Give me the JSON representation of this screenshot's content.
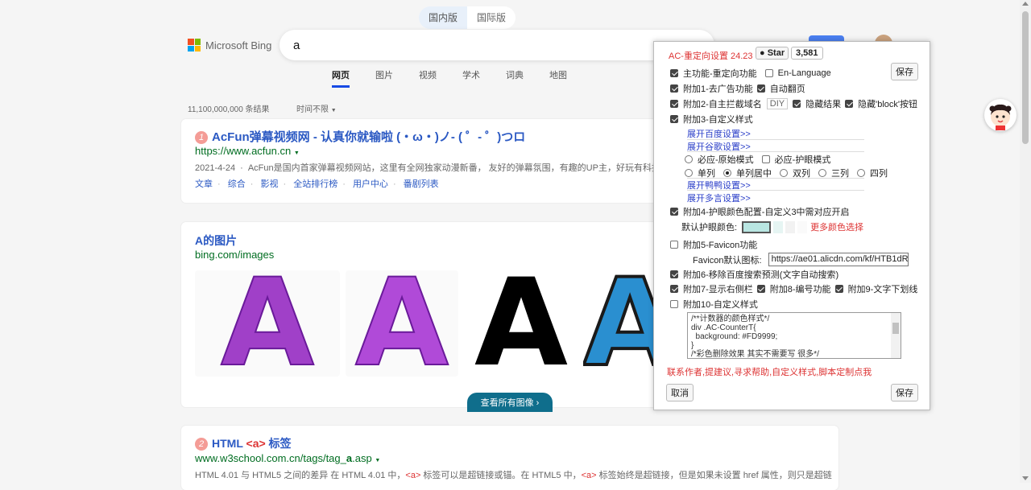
{
  "region_tabs": [
    "国内版",
    "国际版"
  ],
  "brand": {
    "name": "Microsoft Bing",
    "colors": [
      "#f25022",
      "#7fba00",
      "#00a4ef",
      "#ffb900"
    ]
  },
  "search": {
    "query": "a"
  },
  "nav": [
    "网页",
    "图片",
    "视频",
    "学术",
    "词典",
    "地图"
  ],
  "result_count": "11,100,000,000 条结果",
  "time_filter": "时间不限",
  "results": [
    {
      "index": "1",
      "title": "AcFun弹幕视频网 - 认真你就输啦 (・ω・)ノ- ( ゜- ゜)つロ",
      "url": "https://www.acfun.cn",
      "date": "2021-4-24",
      "snippet": "AcFun是国内首家弹幕视频网站，这里有全网独家动漫新番， 友好的弹幕氛围，有趣的UP主，好玩有科技",
      "links": [
        "文章",
        "综合",
        "影视",
        "全站排行榜",
        "用户中心",
        "番剧列表"
      ]
    },
    {
      "index": "2",
      "title_pre": "HTML ",
      "title_tag": "<a>",
      "title_post": " 标签",
      "url_pre": "www.w3school.com.cn/tags/tag_",
      "url_bold": "a",
      "url_post": ".asp",
      "snippet_1": "HTML 4.01 与 HTML5 之间的差异 在 HTML 4.01 中，",
      "snippet_tag": "<a>",
      "snippet_2": " 标签可以是超链接或锚。在 HTML5 中，",
      "snippet_tag2": "<a>",
      "snippet_3": " 标签始终是超链接，但是如果未设置 href 属性，则只是超链"
    }
  ],
  "images": {
    "title": "A的图片",
    "url": "bing.com/images",
    "letter": "A",
    "see_all": "查看所有图像"
  },
  "panel": {
    "title": "AC-重定向设置 24.23",
    "star_label": "Star",
    "star_count": "3,581",
    "save": "保存",
    "cancel": "取消",
    "rows": {
      "main": "主功能-重定向功能",
      "en_lang": "En-Language",
      "ad": "附加1-去广告功能",
      "autopage": "自动翻页",
      "block": "附加2-自主拦截域名",
      "diy": "DIY",
      "hide_result": "隐藏结果",
      "hide_block_btn": "隐藏'block'按钮",
      "custom3": "附加3-自定义样式",
      "expand_baidu": "展开百度设置>>",
      "expand_google": "展开谷歌设置>>",
      "must_orig": "必应-原始模式",
      "must_guard": "必应-护眼模式",
      "col1": "单列",
      "col1c": "单列居中",
      "col2": "双列",
      "col3": "三列",
      "col4": "四列",
      "expand_duck": "展开鸭鸭设置>>",
      "expand_multi": "展开多言设置>>",
      "eye": "附加4-护眼颜色配置-自定义3中需对应开启",
      "eye_default": "默认护眼颜色:",
      "more_colors": "更多颜色选择",
      "favicon": "附加5-Favicon功能",
      "favicon_default": "Favicon默认图标:",
      "favicon_url": "https://ae01.alicdn.com/kf/HTB1dR",
      "remove_predict": "附加6-移除百度搜索预测(文字自动搜索)",
      "sidebar": "附加7-显示右侧栏",
      "numbering": "附加8-编号功能",
      "underline": "附加9-文字下划线",
      "custom10": "附加10-自定义样式",
      "css_text": "/**计数器的颜色样式*/\ndiv .AC-CounterT{\n  background: #FD9999;\n}\n/*彩色删除效果 其实不需要写 很多*/",
      "contact": "联系作者,提建议,寻求帮助,自定义样式,脚本定制点我"
    },
    "colors": {
      "title_red": "#d33333",
      "eye_color": "#b9e6e2"
    }
  }
}
